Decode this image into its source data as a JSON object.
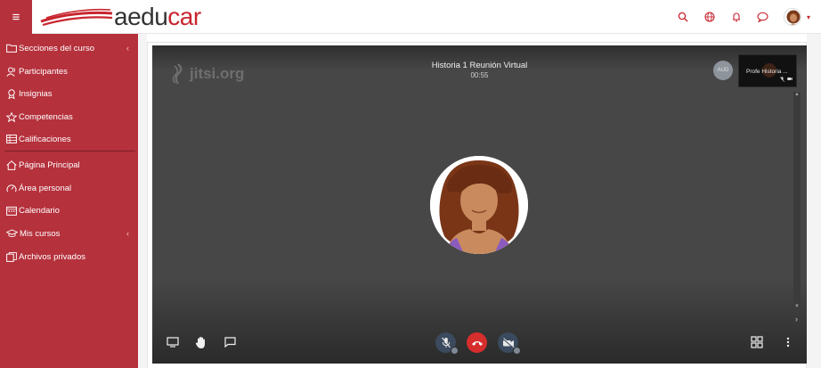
{
  "header": {
    "logo_text_main": "aedu",
    "logo_text_accent": "car"
  },
  "sidebar": {
    "items": [
      {
        "label": "Secciones del curso",
        "icon": "folder-icon",
        "chevron": "‹"
      },
      {
        "label": "Participantes",
        "icon": "users-icon"
      },
      {
        "label": "Insignias",
        "icon": "badge-icon"
      },
      {
        "label": "Competencias",
        "icon": "star-icon"
      },
      {
        "label": "Calificaciones",
        "icon": "table-icon"
      },
      {
        "label": "Página Principal",
        "icon": "home-icon"
      },
      {
        "label": "Área personal",
        "icon": "dashboard-icon"
      },
      {
        "label": "Calendario",
        "icon": "calendar-icon"
      },
      {
        "label": "Mis cursos",
        "icon": "graduation-cap-icon",
        "chevron": "‹"
      },
      {
        "label": "Archivos privados",
        "icon": "files-icon"
      }
    ]
  },
  "meeting": {
    "watermark": "jitsi.org",
    "title": "Historia 1 Reunión Virtual",
    "timer": "00:55",
    "aud_badge": "AUD",
    "thumbnail_name": "Profe Historia ..."
  },
  "colors": {
    "brand_red": "#b5313c",
    "logo_red": "#c8252f",
    "jitsi_bg": "#474747",
    "hangup_red": "#d62d2d"
  }
}
